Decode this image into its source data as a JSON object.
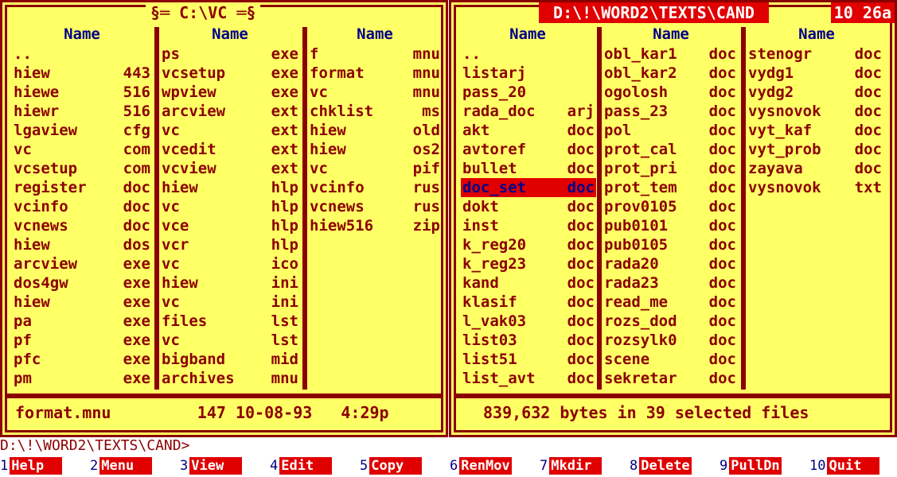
{
  "left_panel": {
    "title": "§═ C:\\VC ═§",
    "columns": [
      {
        "header": "Name",
        "rows": [
          {
            "name": "..",
            "ext": ""
          },
          {
            "name": "hiew",
            "ext": "443"
          },
          {
            "name": "hiewe",
            "ext": "516"
          },
          {
            "name": "hiewr",
            "ext": "516"
          },
          {
            "name": "lgaview",
            "ext": "cfg"
          },
          {
            "name": "vc",
            "ext": "com"
          },
          {
            "name": "vcsetup",
            "ext": "com"
          },
          {
            "name": "register",
            "ext": "doc"
          },
          {
            "name": "vcinfo",
            "ext": "doc"
          },
          {
            "name": "vcnews",
            "ext": "doc"
          },
          {
            "name": "hiew",
            "ext": "dos"
          },
          {
            "name": "arcview",
            "ext": "exe"
          },
          {
            "name": "dos4gw",
            "ext": "exe"
          },
          {
            "name": "hiew",
            "ext": "exe"
          },
          {
            "name": "pa",
            "ext": "exe"
          },
          {
            "name": "pf",
            "ext": "exe"
          },
          {
            "name": "pfc",
            "ext": "exe"
          },
          {
            "name": "pm",
            "ext": "exe"
          }
        ]
      },
      {
        "header": "Name",
        "rows": [
          {
            "name": "ps",
            "ext": "exe"
          },
          {
            "name": "vcsetup",
            "ext": "exe"
          },
          {
            "name": "wpview",
            "ext": "exe"
          },
          {
            "name": "arcview",
            "ext": "ext"
          },
          {
            "name": "vc",
            "ext": "ext"
          },
          {
            "name": "vcedit",
            "ext": "ext"
          },
          {
            "name": "vcview",
            "ext": "ext"
          },
          {
            "name": "hiew",
            "ext": "hlp"
          },
          {
            "name": "vc",
            "ext": "hlp"
          },
          {
            "name": "vce",
            "ext": "hlp"
          },
          {
            "name": "vcr",
            "ext": "hlp"
          },
          {
            "name": "vc",
            "ext": "ico"
          },
          {
            "name": "hiew",
            "ext": "ini"
          },
          {
            "name": "vc",
            "ext": "ini"
          },
          {
            "name": "files",
            "ext": "lst"
          },
          {
            "name": "vc",
            "ext": "lst"
          },
          {
            "name": "bigband",
            "ext": "mid"
          },
          {
            "name": "archives",
            "ext": "mnu"
          }
        ]
      },
      {
        "header": "Name",
        "rows": [
          {
            "name": "f",
            "ext": "mnu"
          },
          {
            "name": "format",
            "ext": "mnu"
          },
          {
            "name": "vc",
            "ext": "mnu"
          },
          {
            "name": "chklist",
            "ext": "ms"
          },
          {
            "name": "hiew",
            "ext": "old"
          },
          {
            "name": "hiew",
            "ext": "os2"
          },
          {
            "name": "vc",
            "ext": "pif"
          },
          {
            "name": "vcinfo",
            "ext": "rus"
          },
          {
            "name": "vcnews",
            "ext": "rus"
          },
          {
            "name": "hiew516",
            "ext": "zip"
          }
        ]
      }
    ],
    "info": "format.mnu         147 10-08-93   4:29p"
  },
  "right_panel": {
    "title": " D:\\!\\WORD2\\TEXTS\\CAND ",
    "clock": "10 26a",
    "columns": [
      {
        "header": "Name",
        "rows": [
          {
            "name": "..",
            "ext": ""
          },
          {
            "name": "listarj",
            "ext": ""
          },
          {
            "name": "pass_20",
            "ext": ""
          },
          {
            "name": "rada_doc",
            "ext": "arj"
          },
          {
            "name": "akt",
            "ext": "doc"
          },
          {
            "name": "avtoref",
            "ext": "doc"
          },
          {
            "name": "bullet",
            "ext": "doc"
          },
          {
            "name": "doc_set",
            "ext": "doc",
            "selected": true
          },
          {
            "name": "dokt",
            "ext": "doc"
          },
          {
            "name": "inst",
            "ext": "doc"
          },
          {
            "name": "k_reg20",
            "ext": "doc"
          },
          {
            "name": "k_reg23",
            "ext": "doc"
          },
          {
            "name": "kand",
            "ext": "doc"
          },
          {
            "name": "klasif",
            "ext": "doc"
          },
          {
            "name": "l_vak03",
            "ext": "doc"
          },
          {
            "name": "list03",
            "ext": "doc"
          },
          {
            "name": "list51",
            "ext": "doc"
          },
          {
            "name": "list_avt",
            "ext": "doc"
          }
        ]
      },
      {
        "header": "Name",
        "rows": [
          {
            "name": "obl_kar1",
            "ext": "doc"
          },
          {
            "name": "obl_kar2",
            "ext": "doc"
          },
          {
            "name": "ogolosh",
            "ext": "doc"
          },
          {
            "name": "pass_23",
            "ext": "doc"
          },
          {
            "name": "pol",
            "ext": "doc"
          },
          {
            "name": "prot_cal",
            "ext": "doc"
          },
          {
            "name": "prot_pri",
            "ext": "doc"
          },
          {
            "name": "prot_tem",
            "ext": "doc"
          },
          {
            "name": "prov0105",
            "ext": "doc"
          },
          {
            "name": "pub0101",
            "ext": "doc"
          },
          {
            "name": "pub0105",
            "ext": "doc"
          },
          {
            "name": "rada20",
            "ext": "doc"
          },
          {
            "name": "rada23",
            "ext": "doc"
          },
          {
            "name": "read_me",
            "ext": "doc"
          },
          {
            "name": "rozs_dod",
            "ext": "doc"
          },
          {
            "name": "rozsylk0",
            "ext": "doc"
          },
          {
            "name": "scene",
            "ext": "doc"
          },
          {
            "name": "sekretar",
            "ext": "doc"
          }
        ]
      },
      {
        "header": "Name",
        "rows": [
          {
            "name": "stenogr",
            "ext": "doc"
          },
          {
            "name": "vydg1",
            "ext": "doc"
          },
          {
            "name": "vydg2",
            "ext": "doc"
          },
          {
            "name": "vysnovok",
            "ext": "doc"
          },
          {
            "name": "vyt_kaf",
            "ext": "doc"
          },
          {
            "name": "vyt_prob",
            "ext": "doc"
          },
          {
            "name": "zayava",
            "ext": "doc"
          },
          {
            "name": "vysnovok",
            "ext": "txt"
          }
        ]
      }
    ],
    "info": "839,632 bytes in 39 selected files"
  },
  "command_line": "D:\\!\\WORD2\\TEXTS\\CAND>",
  "function_keys": [
    {
      "num": "1",
      "label": "Help  "
    },
    {
      "num": "2",
      "label": "Menu  "
    },
    {
      "num": "3",
      "label": "View  "
    },
    {
      "num": "4",
      "label": "Edit  "
    },
    {
      "num": "5",
      "label": "Copy  "
    },
    {
      "num": "6",
      "label": "RenMov"
    },
    {
      "num": "7",
      "label": "Mkdir "
    },
    {
      "num": "8",
      "label": "Delete"
    },
    {
      "num": "9",
      "label": "PullDn"
    },
    {
      "num": "10",
      "label": "Quit  "
    }
  ],
  "colors": {
    "panel_bg": "#ffff66",
    "frame": "#8b0000",
    "highlight": "#e00000",
    "header_text": "#00008b"
  }
}
